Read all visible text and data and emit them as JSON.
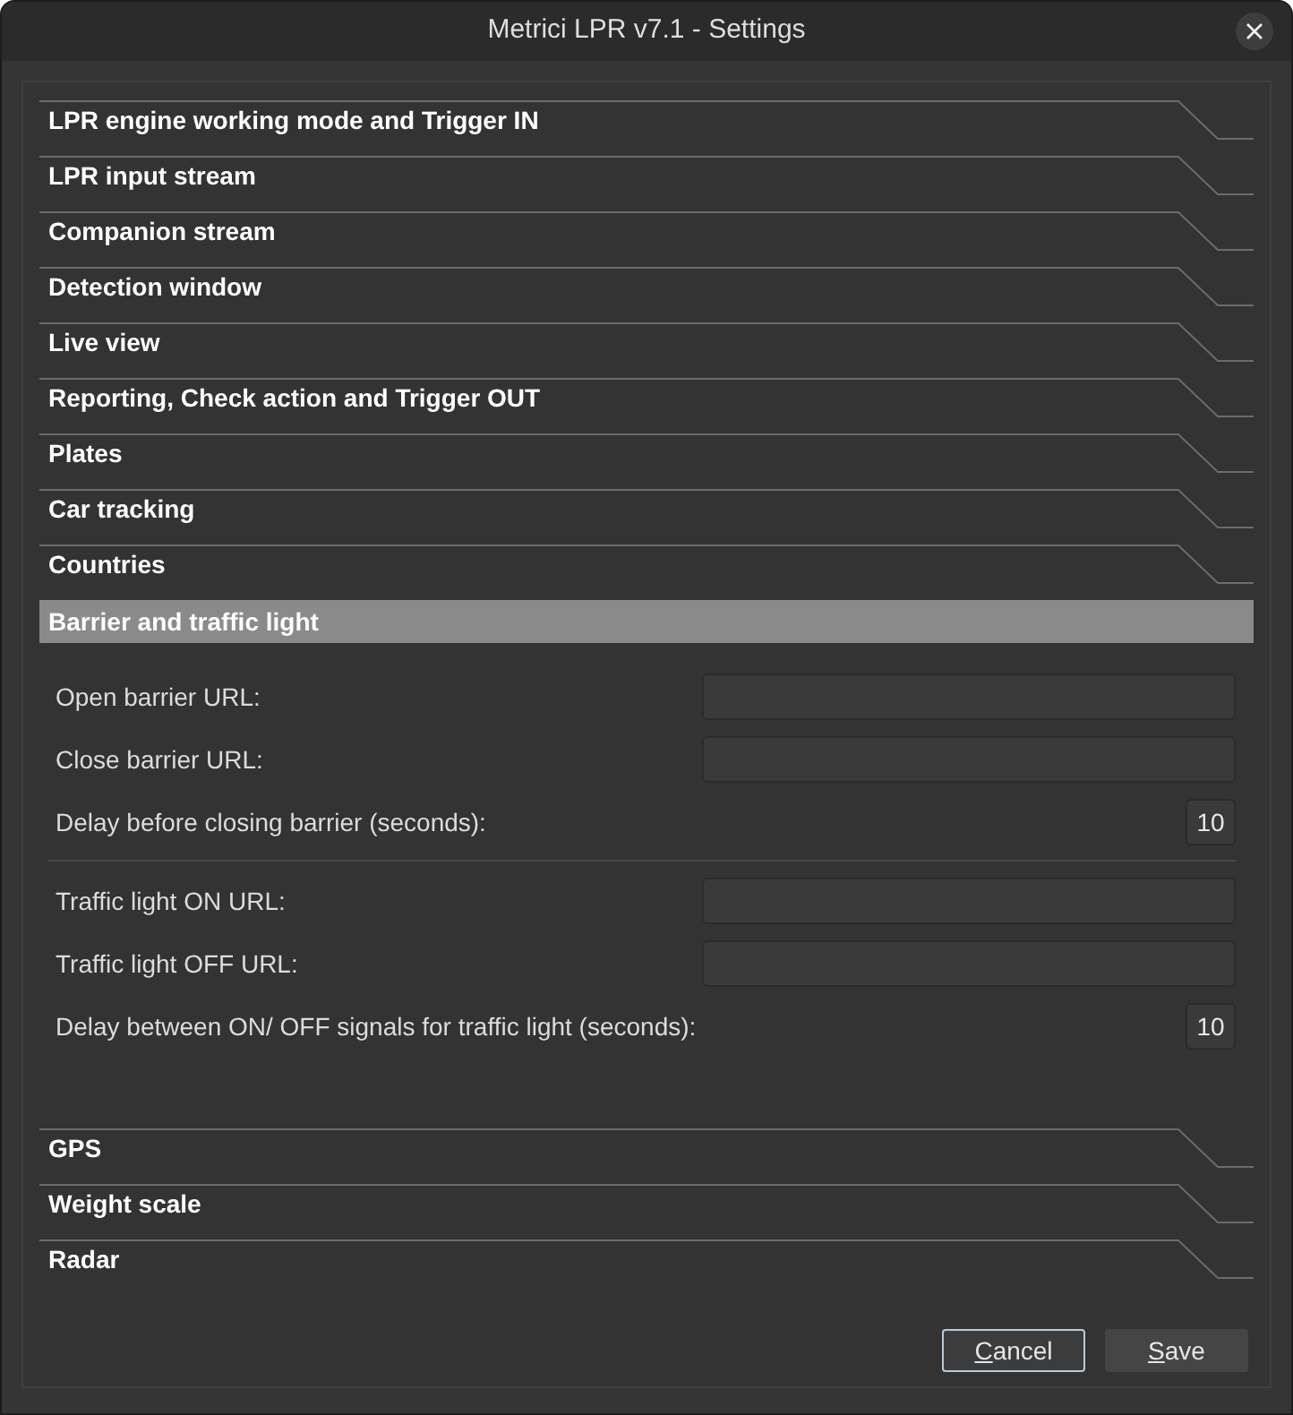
{
  "window": {
    "title": "Metrici LPR v7.1 - Settings"
  },
  "sections": [
    {
      "title": "LPR engine working mode and Trigger IN",
      "expanded": false
    },
    {
      "title": "LPR input stream",
      "expanded": false
    },
    {
      "title": "Companion stream",
      "expanded": false
    },
    {
      "title": "Detection window",
      "expanded": false
    },
    {
      "title": "Live view",
      "expanded": false
    },
    {
      "title": "Reporting, Check action and Trigger OUT",
      "expanded": false
    },
    {
      "title": "Plates",
      "expanded": false
    },
    {
      "title": "Car tracking",
      "expanded": false
    },
    {
      "title": "Countries",
      "expanded": false
    },
    {
      "title": "Barrier and traffic light",
      "expanded": true,
      "groups": [
        {
          "fields": [
            {
              "label": "Open barrier URL:",
              "kind": "text"
            },
            {
              "label": "Close barrier URL:",
              "kind": "text"
            },
            {
              "label": "Delay before closing barrier (seconds):",
              "kind": "number",
              "value": "10"
            }
          ]
        },
        {
          "fields": [
            {
              "label": "Traffic light ON URL:",
              "kind": "text"
            },
            {
              "label": "Traffic light OFF URL:",
              "kind": "text"
            },
            {
              "label": "Delay between ON/ OFF signals for traffic light (seconds):",
              "kind": "number",
              "value": "10"
            }
          ]
        }
      ]
    },
    {
      "title": "GPS",
      "expanded": false
    },
    {
      "title": "Weight scale",
      "expanded": false
    },
    {
      "title": "Radar",
      "expanded": false
    }
  ],
  "buttons": [
    {
      "label": "Cancel",
      "focused": true,
      "mnemonic_underlined": true
    },
    {
      "label": "Save",
      "focused": false,
      "mnemonic_underlined": true
    }
  ]
}
